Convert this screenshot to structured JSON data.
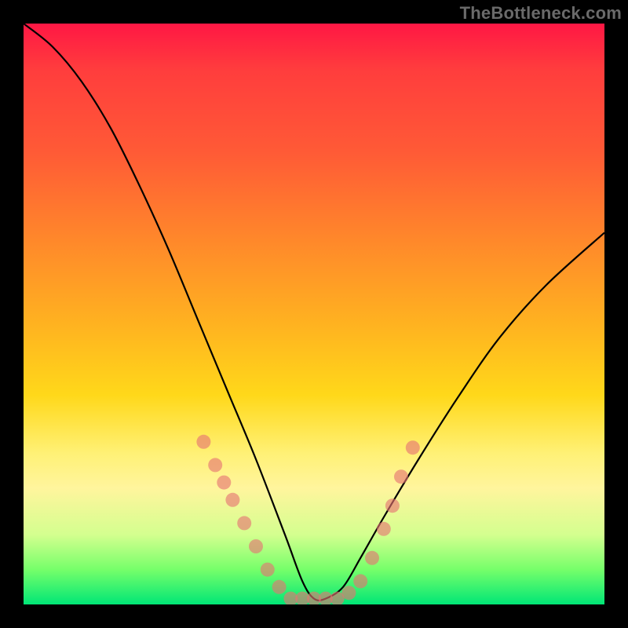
{
  "watermark": "TheBottleneck.com",
  "colors": {
    "gradient_top": "#ff1744",
    "gradient_mid1": "#ff8a2a",
    "gradient_mid2": "#ffd81a",
    "gradient_bottom": "#00e676",
    "curve": "#000000",
    "marker": "#e57373",
    "frame": "#000000"
  },
  "chart_data": {
    "type": "line",
    "title": "",
    "xlabel": "",
    "ylabel": "",
    "xlim": [
      0,
      100
    ],
    "ylim": [
      0,
      100
    ],
    "series": [
      {
        "name": "bottleneck-curve",
        "x": [
          0,
          5,
          10,
          15,
          20,
          25,
          30,
          35,
          40,
          45,
          48,
          50,
          52,
          55,
          58,
          62,
          68,
          75,
          82,
          90,
          100
        ],
        "y": [
          100,
          96,
          90,
          82,
          72,
          61,
          49,
          37,
          25,
          12,
          4,
          1,
          1,
          3,
          8,
          15,
          25,
          36,
          46,
          55,
          64
        ]
      }
    ],
    "markers": {
      "name": "highlight-points",
      "x": [
        31,
        33,
        34.5,
        36,
        38,
        40,
        42,
        44,
        46,
        48,
        50,
        52,
        54,
        56,
        58,
        60,
        62,
        63.5,
        65,
        67
      ],
      "y": [
        28,
        24,
        21,
        18,
        14,
        10,
        6,
        3,
        1,
        1,
        1,
        1,
        1,
        2,
        4,
        8,
        13,
        17,
        22,
        27
      ]
    }
  }
}
